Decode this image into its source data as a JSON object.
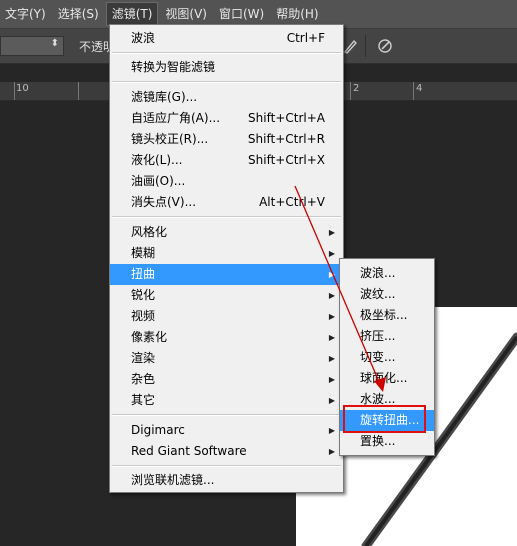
{
  "menubar": {
    "items": [
      {
        "label": "文字(Y)"
      },
      {
        "label": "选择(S)"
      },
      {
        "label": "滤镜(T)",
        "active": true
      },
      {
        "label": "视图(V)"
      },
      {
        "label": "窗口(W)"
      },
      {
        "label": "帮助(H)"
      }
    ]
  },
  "options_bar": {
    "opacity_label": "不透明"
  },
  "ruler": {
    "labels": [
      "10",
      "2",
      "4"
    ]
  },
  "filter_menu": {
    "last_filter": {
      "label": "波浪",
      "shortcut": "Ctrl+F"
    },
    "convert_smart": {
      "label": "转换为智能滤镜"
    },
    "filter_gallery": {
      "label": "滤镜库(G)..."
    },
    "adaptive_wide": {
      "label": "自适应广角(A)...",
      "shortcut": "Shift+Ctrl+A"
    },
    "lens_correction": {
      "label": "镜头校正(R)...",
      "shortcut": "Shift+Ctrl+R"
    },
    "liquify": {
      "label": "液化(L)...",
      "shortcut": "Shift+Ctrl+X"
    },
    "oil_paint": {
      "label": "油画(O)..."
    },
    "vanishing_point": {
      "label": "消失点(V)...",
      "shortcut": "Alt+Ctrl+V"
    },
    "stylize": {
      "label": "风格化"
    },
    "blur": {
      "label": "模糊"
    },
    "distort": {
      "label": "扭曲",
      "highlighted": true
    },
    "sharpen": {
      "label": "锐化"
    },
    "video": {
      "label": "视频"
    },
    "pixelate": {
      "label": "像素化"
    },
    "render": {
      "label": "渲染"
    },
    "noise": {
      "label": "杂色"
    },
    "other": {
      "label": "其它"
    },
    "digimarc": {
      "label": "Digimarc"
    },
    "red_giant": {
      "label": "Red Giant Software"
    },
    "browse_online": {
      "label": "浏览联机滤镜..."
    }
  },
  "distort_submenu": {
    "items": [
      {
        "label": "波浪..."
      },
      {
        "label": "波纹..."
      },
      {
        "label": "极坐标..."
      },
      {
        "label": "挤压..."
      },
      {
        "label": "切变..."
      },
      {
        "label": "球面化..."
      },
      {
        "label": "水波..."
      },
      {
        "label": "旋转扭曲...",
        "highlighted": true
      },
      {
        "label": "置换..."
      }
    ]
  },
  "icons": {
    "submenu_arrow": "triangle-right-icon",
    "annotation_arrow_color": "#cc0000",
    "annotation_box_color": "#e01010"
  },
  "colors": {
    "menu_highlight": "#3399ff",
    "menu_bg": "#f0f0f0",
    "app_bg": "#262626"
  }
}
